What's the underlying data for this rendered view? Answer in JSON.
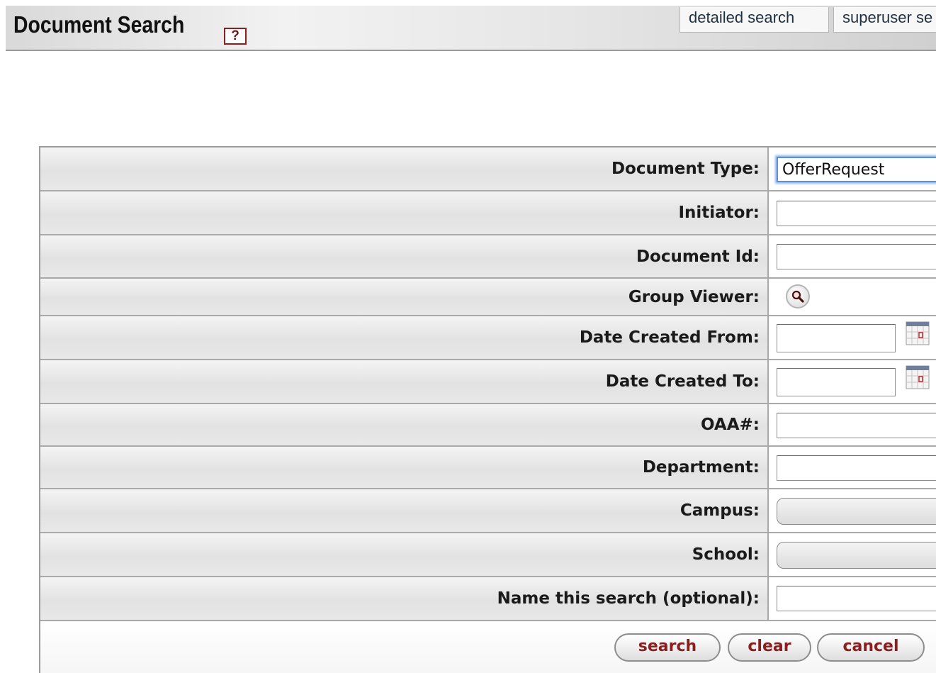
{
  "header": {
    "title": "Document Search",
    "help_glyph": "?",
    "tabs": [
      {
        "label": "detailed search"
      },
      {
        "label": "superuser se"
      }
    ]
  },
  "form": {
    "fields": [
      {
        "label": "Document Type:",
        "value": "OfferRequest",
        "type": "text",
        "focused": true
      },
      {
        "label": "Initiator:",
        "value": "",
        "type": "text"
      },
      {
        "label": "Document Id:",
        "value": "",
        "type": "text"
      },
      {
        "label": "Group Viewer:",
        "type": "lookup",
        "icon": "magnifier-lookup-icon"
      },
      {
        "label": "Date Created From:",
        "value": "",
        "type": "date",
        "icon": "calendar-icon"
      },
      {
        "label": "Date Created To:",
        "value": "",
        "type": "date",
        "icon": "calendar-icon"
      },
      {
        "label": "OAA#:",
        "value": "",
        "type": "text"
      },
      {
        "label": "Department:",
        "value": "",
        "type": "text"
      },
      {
        "label": "Campus:",
        "value": "",
        "type": "select"
      },
      {
        "label": "School:",
        "value": "",
        "type": "select"
      },
      {
        "label": "Name this search (optional):",
        "value": "",
        "type": "text"
      }
    ],
    "buttons": {
      "search": "search",
      "clear": "clear",
      "cancel": "cancel"
    }
  },
  "colors": {
    "button_text": "#8a1f1f",
    "focus_ring": "#5b8fd6",
    "tab_text": "#1f3040"
  }
}
